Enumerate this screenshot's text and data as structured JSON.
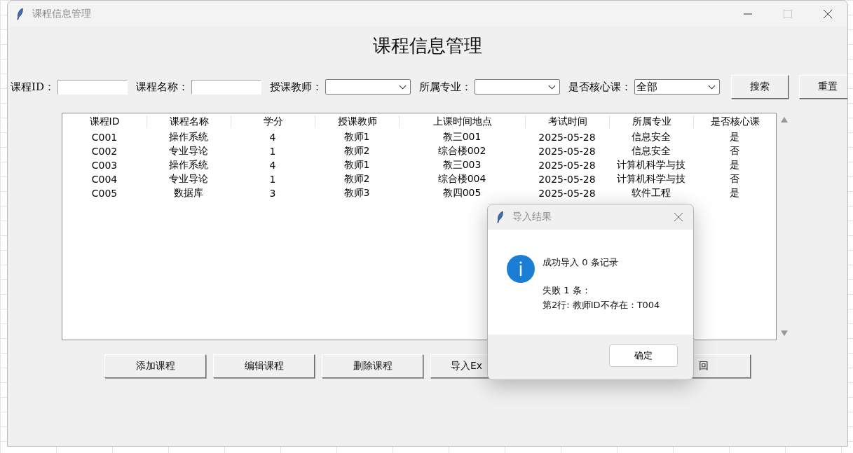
{
  "window": {
    "title": "课程信息管理"
  },
  "heading": "课程信息管理",
  "filters": [
    {
      "kind": "text",
      "label": "课程ID："
    },
    {
      "kind": "text",
      "label": "课程名称："
    },
    {
      "kind": "combo",
      "label": "授课教师："
    },
    {
      "kind": "combo",
      "label": "所属专业："
    },
    {
      "kind": "combo",
      "label": "是否核心课：",
      "value": "全部"
    }
  ],
  "search_buttons": [
    "搜索",
    "重置"
  ],
  "table": {
    "columns": [
      "课程ID",
      "课程名称",
      "学分",
      "授课教师",
      "上课时间地点",
      "考试时间",
      "所属专业",
      "是否核心课"
    ],
    "rows": [
      [
        "C001",
        "操作系统",
        "4",
        "教师1",
        "教三001",
        "2025-05-28",
        "信息安全",
        "是"
      ],
      [
        "C002",
        "专业导论",
        "1",
        "教师2",
        "综合楼002",
        "2025-05-28",
        "信息安全",
        "否"
      ],
      [
        "C003",
        "操作系统",
        "4",
        "教师1",
        "教三003",
        "2025-05-28",
        "计算机科学与技",
        "是"
      ],
      [
        "C004",
        "专业导论",
        "1",
        "教师2",
        "综合楼004",
        "2025-05-28",
        "计算机科学与技",
        "否"
      ],
      [
        "C005",
        "数据库",
        "3",
        "教师3",
        "教四005",
        "2025-05-28",
        "软件工程",
        "是"
      ]
    ]
  },
  "buttons": [
    "添加课程",
    "编辑课程",
    "删除课程",
    "导入Ex",
    "回"
  ],
  "dialog": {
    "title": "导入结果",
    "message": "成功导入 0 条记录",
    "details": [
      "失败 1 条：",
      "第2行: 教师ID不存在：T004"
    ],
    "button": "确定"
  }
}
